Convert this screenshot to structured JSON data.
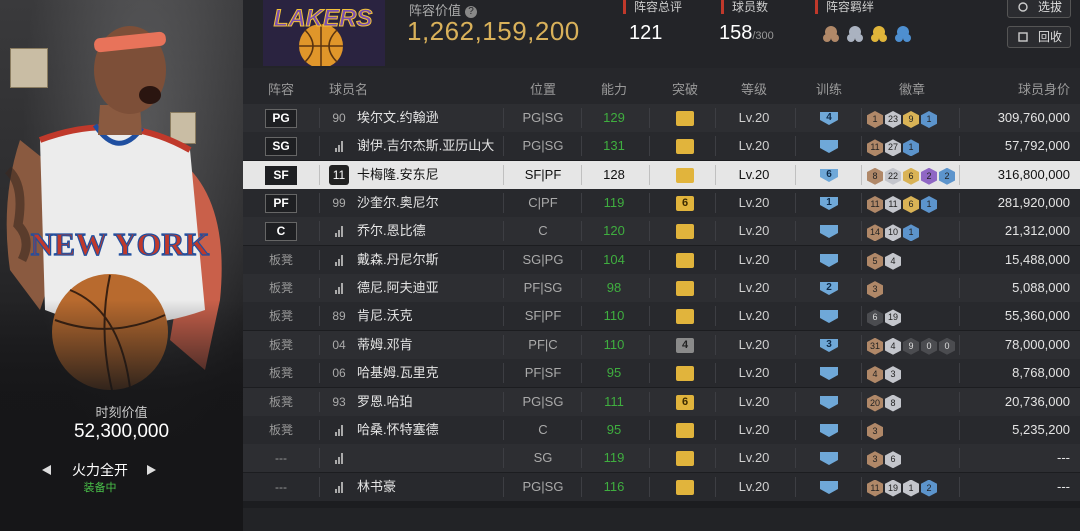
{
  "left_panel": {
    "moment_label": "时刻价值",
    "moment_value": "52,300,000",
    "card_name": "火力全开",
    "card_status": "装备中",
    "jersey_text": "NEW YORK"
  },
  "header": {
    "team_logo_text": "LAKERS",
    "value_label": "阵容价值",
    "value_number": "1,262,159,200",
    "stats": [
      {
        "label": "阵容总评",
        "value": "121",
        "suffix": ""
      },
      {
        "label": "球员数",
        "value": "158",
        "suffix": "/300"
      },
      {
        "label": "阵容羁绊",
        "value": "",
        "suffix": ""
      }
    ],
    "select_button": "选拔",
    "recycle_button": "回收"
  },
  "table": {
    "columns": [
      "阵容",
      "球员名",
      "位置",
      "能力",
      "突破",
      "等级",
      "训练",
      "徽章",
      "球员身价"
    ],
    "rows": [
      {
        "slot": "PG",
        "num": "90",
        "name": "埃尔文.约翰逊",
        "pos": "PG|SG",
        "ability": "129",
        "breakthrough": "",
        "level": "Lv.20",
        "train": "4",
        "badges": [
          {
            "t": "bronze",
            "v": "1"
          },
          {
            "t": "silver",
            "v": "23"
          },
          {
            "t": "gold",
            "v": "9"
          },
          {
            "t": "blue",
            "v": "1"
          }
        ],
        "value": "309,760,000"
      },
      {
        "slot": "SG",
        "num": "",
        "name": "谢伊.吉尔杰斯.亚历山大",
        "pos": "PG|SG",
        "ability": "131",
        "breakthrough": "",
        "level": "Lv.20",
        "train": "",
        "badges": [
          {
            "t": "bronze",
            "v": "11"
          },
          {
            "t": "silver",
            "v": "27"
          },
          {
            "t": "blue",
            "v": "1"
          }
        ],
        "value": "57,792,000"
      },
      {
        "slot": "SF",
        "num": "11",
        "name": "卡梅隆.安东尼",
        "pos": "SF|PF",
        "ability": "128",
        "breakthrough": "",
        "level": "Lv.20",
        "train": "6",
        "badges": [
          {
            "t": "bronze",
            "v": "8"
          },
          {
            "t": "silver",
            "v": "22"
          },
          {
            "t": "gold",
            "v": "6"
          },
          {
            "t": "purple",
            "v": "2"
          },
          {
            "t": "blue",
            "v": "2"
          }
        ],
        "value": "316,800,000"
      },
      {
        "slot": "PF",
        "num": "99",
        "name": "沙奎尔.奥尼尔",
        "pos": "C|PF",
        "ability": "119",
        "breakthrough": "6",
        "level": "Lv.20",
        "train": "1",
        "badges": [
          {
            "t": "bronze",
            "v": "11"
          },
          {
            "t": "silver",
            "v": "11"
          },
          {
            "t": "gold",
            "v": "6"
          },
          {
            "t": "blue",
            "v": "1"
          }
        ],
        "value": "281,920,000"
      },
      {
        "slot": "C",
        "num": "",
        "name": "乔尔.恩比德",
        "pos": "C",
        "ability": "120",
        "breakthrough": "",
        "level": "Lv.20",
        "train": "",
        "badges": [
          {
            "t": "bronze",
            "v": "14"
          },
          {
            "t": "silver",
            "v": "10"
          },
          {
            "t": "blue",
            "v": "1"
          }
        ],
        "value": "21,312,000"
      },
      {
        "slot": "板凳",
        "num": "",
        "name": "戴森.丹尼尔斯",
        "pos": "SG|PG",
        "ability": "104",
        "breakthrough": "",
        "level": "Lv.20",
        "train": "",
        "badges": [
          {
            "t": "bronze",
            "v": "5"
          },
          {
            "t": "silver",
            "v": "4"
          }
        ],
        "value": "15,488,000"
      },
      {
        "slot": "板凳",
        "num": "",
        "name": "德尼.阿夫迪亚",
        "pos": "PF|SG",
        "ability": "98",
        "breakthrough": "",
        "level": "Lv.20",
        "train": "2",
        "badges": [
          {
            "t": "bronze",
            "v": "3"
          }
        ],
        "value": "5,088,000"
      },
      {
        "slot": "板凳",
        "num": "89",
        "name": "肯尼.沃克",
        "pos": "SF|PF",
        "ability": "110",
        "breakthrough": "",
        "level": "Lv.20",
        "train": "",
        "badges": [
          {
            "t": "dark",
            "v": "6"
          },
          {
            "t": "silver",
            "v": "19"
          }
        ],
        "value": "55,360,000"
      },
      {
        "slot": "板凳",
        "num": "04",
        "name": "蒂姆.邓肯",
        "pos": "PF|C",
        "ability": "110",
        "breakthrough": "4",
        "level": "Lv.20",
        "train": "3",
        "badges": [
          {
            "t": "bronze",
            "v": "31"
          },
          {
            "t": "silver",
            "v": "4"
          },
          {
            "t": "dark",
            "v": "9"
          },
          {
            "t": "dark",
            "v": "0"
          },
          {
            "t": "dark",
            "v": "0"
          }
        ],
        "value": "78,000,000"
      },
      {
        "slot": "板凳",
        "num": "06",
        "name": "哈基姆.瓦里克",
        "pos": "PF|SF",
        "ability": "95",
        "breakthrough": "",
        "level": "Lv.20",
        "train": "",
        "badges": [
          {
            "t": "bronze",
            "v": "4"
          },
          {
            "t": "silver",
            "v": "3"
          }
        ],
        "value": "8,768,000"
      },
      {
        "slot": "板凳",
        "num": "93",
        "name": "罗恩.哈珀",
        "pos": "PG|SG",
        "ability": "111",
        "breakthrough": "6",
        "level": "Lv.20",
        "train": "",
        "badges": [
          {
            "t": "bronze",
            "v": "20"
          },
          {
            "t": "silver",
            "v": "8"
          }
        ],
        "value": "20,736,000"
      },
      {
        "slot": "板凳",
        "num": "",
        "name": "哈桑.怀特塞德",
        "pos": "C",
        "ability": "95",
        "breakthrough": "",
        "level": "Lv.20",
        "train": "",
        "badges": [
          {
            "t": "bronze",
            "v": "3"
          }
        ],
        "value": "5,235,200"
      },
      {
        "slot": "---",
        "num": "",
        "name": "",
        "pos": "SG",
        "ability": "119",
        "breakthrough": "",
        "level": "Lv.20",
        "train": "",
        "badges": [
          {
            "t": "bronze",
            "v": "3"
          },
          {
            "t": "silver",
            "v": "6"
          }
        ],
        "value": "---"
      },
      {
        "slot": "---",
        "num": "",
        "name": "林书豪",
        "pos": "PG|SG",
        "ability": "116",
        "breakthrough": "",
        "level": "Lv.20",
        "train": "",
        "badges": [
          {
            "t": "bronze",
            "v": "11"
          },
          {
            "t": "silver",
            "v": "19"
          },
          {
            "t": "silver",
            "v": "1"
          },
          {
            "t": "blue",
            "v": "2"
          }
        ],
        "value": "---"
      }
    ]
  },
  "colors": {
    "ability_green": "#3fae3f",
    "value_gold": "#d9b15a",
    "accent_red": "#c0392b",
    "selected_row": "#e6e6e6"
  }
}
